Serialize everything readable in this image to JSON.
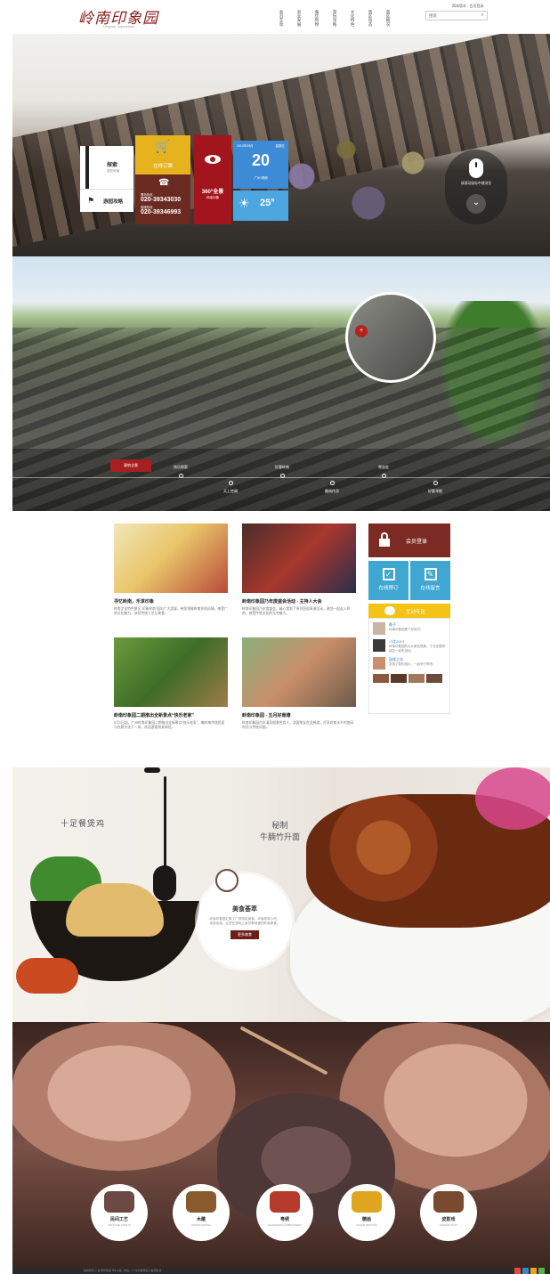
{
  "header": {
    "logo_text": "岭南印象园",
    "logo_sub": "Lingnan Impression",
    "nav": [
      "会员互动",
      "商业发展",
      "餐饮购物",
      "游玩攻略",
      "文化特色",
      "景区动态",
      "景区概况"
    ],
    "toplinks": "简体版本 · 会员登录",
    "search_placeholder": "搜索"
  },
  "hero": {
    "explore_title": "探索",
    "explore_sub": "游在岭南",
    "guide_label": "游园攻略",
    "order_label": "在线订票",
    "phone_label1": "票务热线",
    "phone1": "020-39343030",
    "phone_label2": "客服热线",
    "phone2": "020-39346993",
    "tour_label": "360°全景",
    "tour_sub": "岭南印象",
    "date_line": "2013年09月",
    "weekday": "星期五",
    "day": "20",
    "city": "广州 晴朗",
    "temp": "25°",
    "scroll_hint": "请滚动鼠标中键浏览"
  },
  "village": {
    "tabs": [
      "建筑全景",
      "快乐探索",
      "天上宫阙",
      "好客岭南",
      "趣闻传奇",
      "常去处",
      "好客寻根"
    ]
  },
  "news": {
    "cards": [
      {
        "title": "寻忆岭南，乐享印象",
        "desc": "岭南文化特色景区“印象岭南”面向广大游客，带您领略岭南民俗风情，感受广府文化魅力，体验传统工艺与美食。"
      },
      {
        "title": "岭南印象园乃年度盛会活动 - 主持人大会",
        "desc": "岭南印象园乃年度盛会，精心策划了系列民俗表演活动，邀您一起走入岭南，感受传统文化的无穷魅力。"
      },
      {
        "title": "岭南印象园二期推出全新景点“快乐老家”",
        "desc": "5月1日起，广州岭南印象园二期推出全新景点“快乐老家”，集岭南传统民居与农耕文化于一体，欢迎游客前来体验。"
      },
      {
        "title": "岭南印象园 - 五月好南塘",
        "desc": "岭南印象园内水清风细景色宜人，游客朋友在此畅游，尽享岭南水乡的悠闲时光与传统风韵。"
      }
    ],
    "member_label": "会员登录",
    "online_book": "在线预订",
    "online_msg": "在线留言",
    "interact_label": "互动专区",
    "feed": [
      {
        "user": "静子",
        "text": "岭南印象园是个好地方！"
      },
      {
        "user": "小花2013",
        "text": "岭南印象园的水乡景色很美，下次还要带朋友一起来游玩。"
      },
      {
        "user": "鼓楼之花",
        "text": "发表了新的相片，一起来分享吧。"
      }
    ]
  },
  "food": {
    "calli_left": "十足餐煲鸡",
    "calli_right_1": "秘制",
    "calli_right_2": "牛腩竹升面",
    "title": "美食荟萃",
    "desc": "岭南印象园汇集了广府特色美食，岭南风味小吃，传统名菜，让您在游玩之余尽享地道的岭南美食。",
    "button": "更多美食"
  },
  "crafts": {
    "items": [
      {
        "name": "民间工艺",
        "en": "ARTS AND CRAFTS"
      },
      {
        "name": "木雕",
        "en": "WOODCARVING"
      },
      {
        "name": "粤绣",
        "en": "GUANGDONG EMBROIDERY"
      },
      {
        "name": "糖画",
        "en": "SUGAR PAINTING"
      },
      {
        "name": "皮影戏",
        "en": "SHADOW PLAY"
      }
    ]
  },
  "footer": {
    "text": "版权所有 © 岭南印象园  粤ICP备 · 地址：广州市番禺区小谷围街道"
  },
  "colors": {
    "brand_red": "#a3151d",
    "yellow": "#e6b31e",
    "blue": "#3d8ad6",
    "member_brown": "#7b2a24",
    "interact_yellow": "#f3c316",
    "button_blue": "#3fa7d1"
  }
}
